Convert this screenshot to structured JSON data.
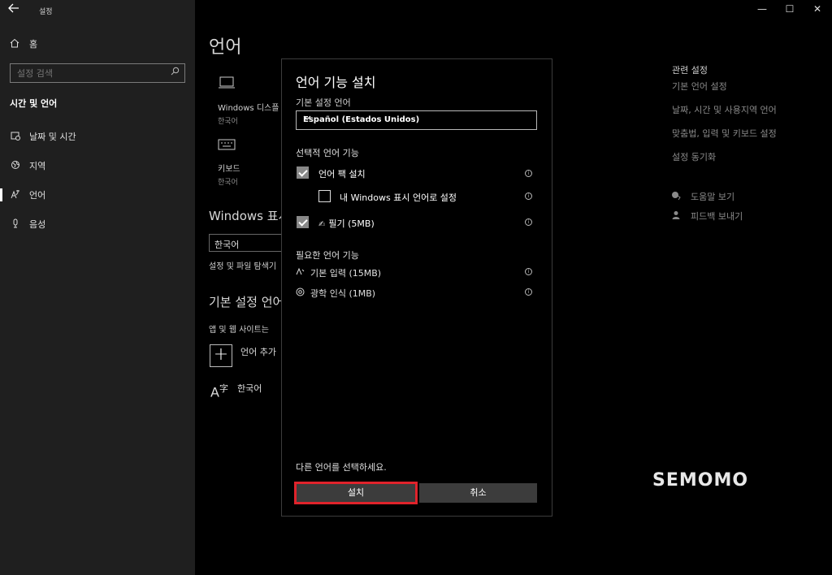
{
  "window": {
    "title": "설정",
    "back_icon": "back-arrow-icon",
    "minimize": "—",
    "maximize": "☐",
    "close": "✕"
  },
  "sidebar": {
    "home_label": "홈",
    "search_placeholder": "설정 검색",
    "section_title": "시간 및 언어",
    "items": [
      {
        "label": "날짜 및 시간",
        "icon": "calendar-clock-icon"
      },
      {
        "label": "지역",
        "icon": "globe-icon"
      },
      {
        "label": "언어",
        "icon": "language-icon"
      },
      {
        "label": "음성",
        "icon": "microphone-icon"
      }
    ]
  },
  "main": {
    "title": "언어",
    "tiles": [
      {
        "label": "Windows 디스플",
        "sub": "한국어"
      },
      {
        "label": "키보드",
        "sub": "한국어"
      }
    ],
    "windows_display_heading": "Windows 표시",
    "display_language_value": "한국어",
    "display_language_desc": "설정 및 파일 탐색기",
    "preferred_heading": "기본 설정 언어",
    "preferred_desc": "앱 및 웹 사이트는",
    "add_language_label": "언어 추가",
    "korean_label": "한국어"
  },
  "related": {
    "title": "관련 설정",
    "links": [
      "기본 언어 설정",
      "날짜, 시간 및 사용지역 언어",
      "맞춤법, 입력 및 키보드 설정",
      "설정 동기화"
    ],
    "help": "도움말 보기",
    "feedback": "피드백 보내기"
  },
  "dialog": {
    "title": "언어 기능 설치",
    "preferred_label": "기본 설정 언어",
    "selected_language": "Español (Estados Unidos)",
    "optional_heading": "선택적 언어 기능",
    "options": [
      {
        "label": "언어 팩 설치",
        "checked": true
      },
      {
        "label": "내 Windows 표시 언어로 설정",
        "checked": false
      },
      {
        "label": "필기 (5MB)",
        "checked": true
      }
    ],
    "required_heading": "필요한 언어 기능",
    "required": [
      {
        "label": "기본 입력 (15MB)",
        "icon": "keyboard-input-icon"
      },
      {
        "label": "광학 인식 (1MB)",
        "icon": "ocr-eye-icon"
      }
    ],
    "footer_text": "다른 언어를 선택하세요.",
    "install_label": "설치",
    "cancel_label": "취소",
    "info_glyph": "i"
  },
  "watermark": "SEMOMO"
}
